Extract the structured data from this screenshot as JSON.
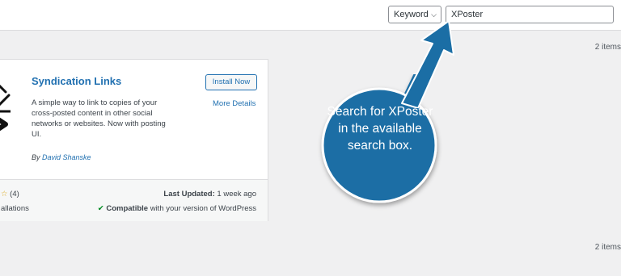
{
  "topbar": {
    "search_type": "Keyword",
    "search_value": "XPoster"
  },
  "items_count_top": "2 items",
  "items_count_bottom": "2 items",
  "plugin": {
    "title": "Syndication Links",
    "description": "A simple way to link to copies of your cross-posted content in other social networks or websites. Now with posting UI.",
    "author_prefix": "By ",
    "author_name": "David Shanske",
    "install_label": "Install Now",
    "more_details_label": "More Details",
    "rating_count": "(4)",
    "installs_text": "allations",
    "last_updated_label": "Last Updated:",
    "last_updated_value": "1 week ago",
    "compat_label": "Compatible",
    "compat_rest": "with your version of WordPress"
  },
  "callout": {
    "text": "Search for XPoster in the available search box.",
    "color": "#1b6ea5"
  }
}
